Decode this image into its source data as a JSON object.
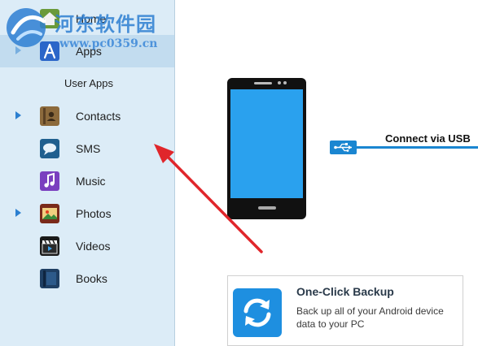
{
  "watermark": {
    "title": "河东软件园",
    "url": "www.pc0359.cn"
  },
  "sidebar": {
    "items": [
      {
        "id": "home",
        "label": "Home",
        "icon": "home-icon"
      },
      {
        "id": "apps",
        "label": "Apps",
        "icon": "apps-store-icon",
        "selected": true
      },
      {
        "id": "user-apps",
        "label": "User Apps"
      },
      {
        "id": "contacts",
        "label": "Contacts",
        "icon": "contacts-book-icon",
        "expandable": true
      },
      {
        "id": "sms",
        "label": "SMS",
        "icon": "sms-chat-icon"
      },
      {
        "id": "music",
        "label": "Music",
        "icon": "music-note-icon"
      },
      {
        "id": "photos",
        "label": "Photos",
        "icon": "photos-icon",
        "expandable": true
      },
      {
        "id": "videos",
        "label": "Videos",
        "icon": "video-clapper-icon"
      },
      {
        "id": "books",
        "label": "Books",
        "icon": "book-icon"
      }
    ]
  },
  "device": {
    "connect_label": "Connect via USB"
  },
  "backup": {
    "title": "One-Click Backup",
    "description": "Back up all of your Android device data to your PC"
  },
  "colors": {
    "sidebar_bg": "#dcecf7",
    "accent_blue": "#1a86d1",
    "phone_screen": "#2aa1ee",
    "annotation_arrow": "#e0262b"
  }
}
